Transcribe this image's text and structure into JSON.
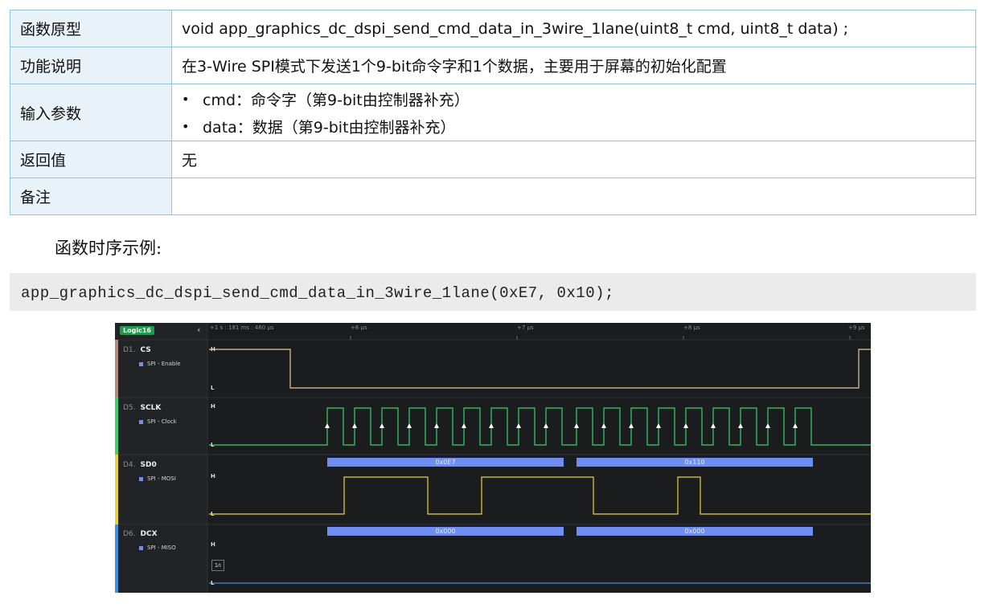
{
  "table": {
    "rows": [
      {
        "key": "函数原型",
        "value": "void app_graphics_dc_dspi_send_cmd_data_in_3wire_1lane(uint8_t cmd, uint8_t data) ;"
      },
      {
        "key": "功能说明",
        "value": "在3-Wire SPI模式下发送1个9-bit命令字和1个数据，主要用于屏幕的初始化配置"
      },
      {
        "key": "输入参数",
        "params": [
          "cmd：命令字（第9-bit由控制器补充）",
          "data：数据（第9-bit由控制器补充）"
        ]
      },
      {
        "key": "返回值",
        "value": "无"
      },
      {
        "key": "备注",
        "value": ""
      }
    ]
  },
  "section_title": "函数时序示例:",
  "code_example": "app_graphics_dc_dspi_send_cmd_data_in_3wire_1lane(0xE7, 0x10);",
  "analyzer": {
    "device": "Logic16",
    "time_origin": "+1 s : 181 ms : 460 µs",
    "time_ticks": [
      "+6 µs",
      "+7 µs",
      "+8 µs",
      "+9 µs"
    ],
    "channels": [
      {
        "num": "D1.",
        "name": "CS",
        "analyzer": "SPI - Enable",
        "color": "#b08a7a"
      },
      {
        "num": "D5.",
        "name": "SCLK",
        "analyzer": "SPI - Clock",
        "color": "#3bd16f"
      },
      {
        "num": "D4.",
        "name": "SD0",
        "analyzer": "SPI - MOSI",
        "color": "#e8d33a"
      },
      {
        "num": "D6.",
        "name": "DCX",
        "analyzer": "SPI - MISO",
        "color": "#3d8fe0"
      }
    ],
    "level_high": "H",
    "level_low": "L",
    "mosi_bytes": [
      "0x0E7",
      "0x110"
    ],
    "miso_bytes": [
      "0x000",
      "0x000"
    ],
    "icon_glyph": "1⁄₀"
  }
}
